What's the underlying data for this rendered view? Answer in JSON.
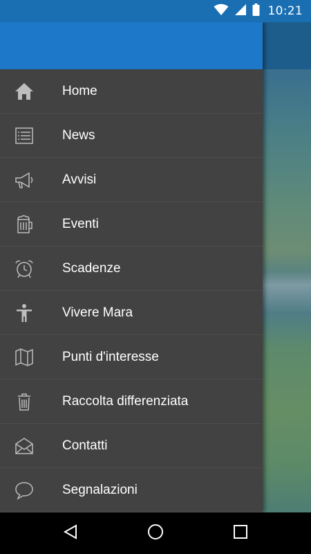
{
  "status_bar": {
    "time": "10:21"
  },
  "menu": [
    {
      "label": "Home",
      "icon": "home-icon"
    },
    {
      "label": "News",
      "icon": "list-icon"
    },
    {
      "label": "Avvisi",
      "icon": "megaphone-icon"
    },
    {
      "label": "Eventi",
      "icon": "beer-mug-icon"
    },
    {
      "label": "Scadenze",
      "icon": "alarm-clock-icon"
    },
    {
      "label": "Vivere Mara",
      "icon": "person-icon"
    },
    {
      "label": "Punti d'interesse",
      "icon": "map-icon"
    },
    {
      "label": "Raccolta differenziata",
      "icon": "trash-icon"
    },
    {
      "label": "Contatti",
      "icon": "envelope-icon"
    },
    {
      "label": "Segnalazioni",
      "icon": "chat-bubble-icon"
    }
  ],
  "colors": {
    "header": "#1d78c9",
    "drawer": "#424242",
    "status_bar": "#1a6fb3"
  }
}
